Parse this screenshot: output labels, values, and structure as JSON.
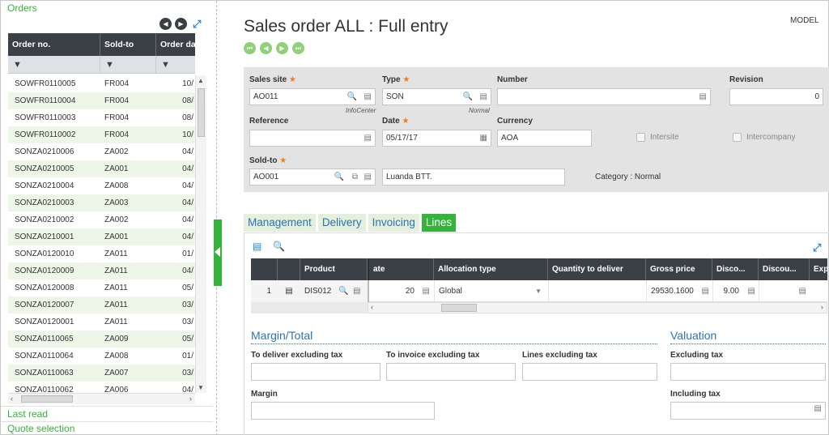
{
  "left": {
    "title": "Orders",
    "columns": [
      "Order no.",
      "Sold-to",
      "Order da"
    ],
    "rows": [
      [
        "SOWFR0110005",
        "FR004",
        "10/"
      ],
      [
        "SOWFR0110004",
        "FR004",
        "08/"
      ],
      [
        "SOWFR0110003",
        "FR004",
        "08/"
      ],
      [
        "SOWFR0110002",
        "FR004",
        "10/"
      ],
      [
        "SONZA0210006",
        "ZA002",
        "04/"
      ],
      [
        "SONZA0210005",
        "ZA001",
        "04/"
      ],
      [
        "SONZA0210004",
        "ZA008",
        "04/"
      ],
      [
        "SONZA0210003",
        "ZA003",
        "04/"
      ],
      [
        "SONZA0210002",
        "ZA002",
        "04/"
      ],
      [
        "SONZA0210001",
        "ZA001",
        "04/"
      ],
      [
        "SONZA0120010",
        "ZA011",
        "01/"
      ],
      [
        "SONZA0120009",
        "ZA011",
        "04/"
      ],
      [
        "SONZA0120008",
        "ZA011",
        "05/"
      ],
      [
        "SONZA0120007",
        "ZA011",
        "03/"
      ],
      [
        "SONZA0120001",
        "ZA011",
        "03/"
      ],
      [
        "SONZA0110065",
        "ZA009",
        "05/"
      ],
      [
        "SONZA0110064",
        "ZA008",
        "01/"
      ],
      [
        "SONZA0110063",
        "ZA007",
        "03/"
      ],
      [
        "SONZA0110062",
        "ZA006",
        "04/"
      ]
    ],
    "last_read": "Last read",
    "quote_selection": "Quote selection"
  },
  "header": {
    "title": "Sales order ALL : Full entry",
    "model": "MODEL"
  },
  "form": {
    "sales_site_label": "Sales site",
    "sales_site_value": "AO011",
    "sales_site_hint": "InfoCenter",
    "type_label": "Type",
    "type_value": "SON",
    "type_hint": "Normal",
    "number_label": "Number",
    "number_value": "",
    "revision_label": "Revision",
    "revision_value": "0",
    "reference_label": "Reference",
    "reference_value": "",
    "date_label": "Date",
    "date_value": "05/17/17",
    "currency_label": "Currency",
    "currency_value": "AOA",
    "intersite_label": "Intersite",
    "intercompany_label": "Intercompany",
    "soldto_label": "Sold-to",
    "soldto_value": "AO001",
    "soldto_name": "Luanda BTT.",
    "category": "Category : Normal",
    "required_mark": "★"
  },
  "tabs": [
    "Management",
    "Delivery",
    "Invoicing",
    "Lines"
  ],
  "grid": {
    "columns": [
      "Product",
      "ate",
      "Allocation type",
      "Quantity to deliver",
      "Gross price",
      "Disco...",
      "Discou...",
      "Exp"
    ],
    "row": {
      "num": "1",
      "product": "DIS012",
      "rate": "20",
      "allocation": "Global",
      "qty_deliver": "",
      "gross_price": "29530.1600",
      "disc1": "9.00",
      "disc2": ""
    }
  },
  "margin": {
    "title": "Margin/Total",
    "to_deliver_label": "To deliver excluding tax",
    "to_invoice_label": "To invoice excluding tax",
    "lines_label": "Lines excluding tax",
    "margin_label": "Margin"
  },
  "valuation": {
    "title": "Valuation",
    "excl_label": "Excluding tax",
    "incl_label": "Including tax"
  },
  "colors": {
    "accent_green": "#36b33a",
    "header_dark": "#3b4047",
    "link_blue": "#2b73b7",
    "required_orange": "#ef7d22"
  }
}
